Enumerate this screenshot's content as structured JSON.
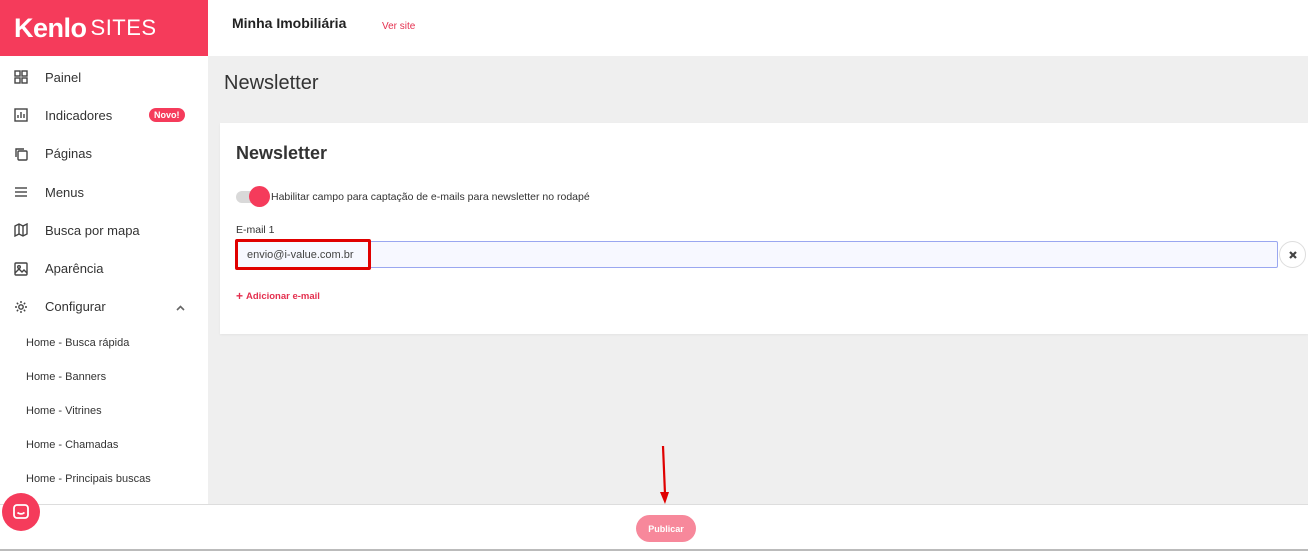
{
  "brand": {
    "logo_main": "Kenlo",
    "logo_sub": "SITES"
  },
  "header": {
    "site_name": "Minha Imobiliária",
    "view_site": "Ver site"
  },
  "sidebar": {
    "items": [
      {
        "label": "Painel",
        "icon": "grid-icon"
      },
      {
        "label": "Indicadores",
        "icon": "bar-chart-icon",
        "badge": "Novo!"
      },
      {
        "label": "Páginas",
        "icon": "copy-icon"
      },
      {
        "label": "Menus",
        "icon": "menu-icon"
      },
      {
        "label": "Busca por mapa",
        "icon": "map-icon"
      },
      {
        "label": "Aparência",
        "icon": "image-icon"
      },
      {
        "label": "Configurar",
        "icon": "gear-icon",
        "expanded": true
      }
    ],
    "subitems": [
      {
        "label": "Home - Busca rápida"
      },
      {
        "label": "Home - Banners"
      },
      {
        "label": "Home - Vitrines"
      },
      {
        "label": "Home - Chamadas"
      },
      {
        "label": "Home - Principais buscas"
      }
    ]
  },
  "main": {
    "page_title": "Newsletter",
    "card": {
      "title": "Newsletter",
      "toggle_label": "Habilitar campo para captação de e-mails para newsletter no rodapé",
      "toggle_on": true,
      "email_label": "E-mail 1",
      "email_value": "envio@i-value.com.br",
      "add_email": "Adicionar e-mail"
    }
  },
  "footer": {
    "publish_label": "Publicar"
  },
  "colors": {
    "brand": "#f53b5b",
    "publish": "#f7889b",
    "annotation": "#e00000"
  }
}
